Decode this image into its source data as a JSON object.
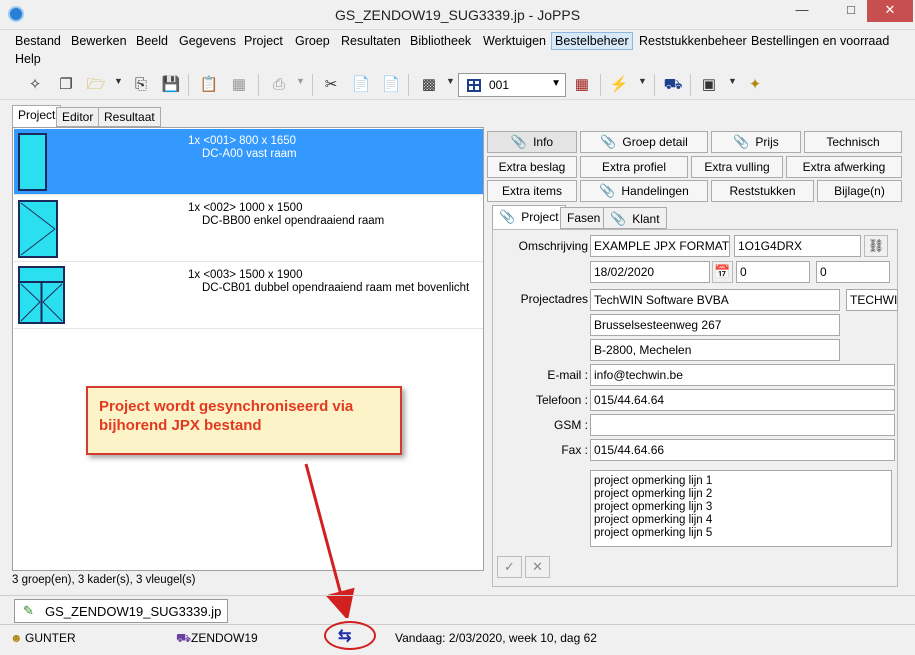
{
  "window": {
    "title": "GS_ZENDOW19_SUG3339.jp - JoPPS"
  },
  "menu": [
    "Bestand",
    "Bewerken",
    "Beeld",
    "Gegevens",
    "Project",
    "Groep",
    "Resultaten",
    "Bibliotheek",
    "Werktuigen",
    "Bestelbeheer",
    "Reststukkenbeheer",
    "Bestellingen en voorraad",
    "Help"
  ],
  "toolbar": {
    "combo_value": "001"
  },
  "left_tabs": [
    "Project",
    "Editor",
    "Resultaat"
  ],
  "items": [
    {
      "line1": "1x <001> 800 x 1650",
      "line2": "DC-A00 vast raam"
    },
    {
      "line1": "1x <002> 1000 x 1500",
      "line2": "DC-BB00 enkel opendraaiend raam"
    },
    {
      "line1": "1x <003> 1500 x 1900",
      "line2": "DC-CB01 dubbel opendraaiend raam met bovenlicht"
    }
  ],
  "left_status": "3 groep(en), 3 kader(s), 3 vleugel(s)",
  "right_buttons": {
    "info": "Info",
    "groep_detail": "Groep detail",
    "prijs": "Prijs",
    "technisch": "Technisch",
    "extra_beslag": "Extra beslag",
    "extra_profiel": "Extra profiel",
    "extra_vulling": "Extra vulling",
    "extra_afwerking": "Extra afwerking",
    "extra_items": "Extra items",
    "handelingen": "Handelingen",
    "reststukken": "Reststukken",
    "bijlagen": "Bijlage(n)"
  },
  "inner_tabs": {
    "project": "Project",
    "fasen": "Fasen",
    "klant": "Klant"
  },
  "form": {
    "omschrijving_label": "Omschrijving",
    "omschrijving": "EXAMPLE JPX FORMAT",
    "code": "1O1G4DRX",
    "date": "18/02/2020",
    "num1": "0",
    "num2": "0",
    "projectadres_label": "Projectadres",
    "adres1": "TechWIN Software BVBA",
    "adres_extra": "TECHWIN",
    "adres2": "Brusselsesteenweg 267",
    "adres3": "B-2800, Mechelen",
    "email_label": "E-mail :",
    "email": "info@techwin.be",
    "telefoon_label": "Telefoon :",
    "telefoon": "015/44.64.64",
    "gsm_label": "GSM :",
    "gsm": "",
    "fax_label": "Fax :",
    "fax": "015/44.64.66",
    "opmerkingen": [
      "project opmerking lijn 1",
      "project opmerking lijn 2",
      "project opmerking lijn 3",
      "project opmerking lijn 4",
      "project opmerking lijn 5"
    ]
  },
  "callout": "Project wordt gesynchroniseerd via bijhorend JPX bestand",
  "doc_tab": "GS_ZENDOW19_SUG3339.jp",
  "status": {
    "user": "GUNTER",
    "database": "ZENDOW19",
    "today": "Vandaag: 2/03/2020, week 10, dag 62"
  },
  "colors": {
    "selection": "#3399ff",
    "glass": "#2ae0f0",
    "callout_border": "#d43a2e",
    "callout_text": "#e23a20",
    "callout_bg": "#fdf3c8"
  }
}
